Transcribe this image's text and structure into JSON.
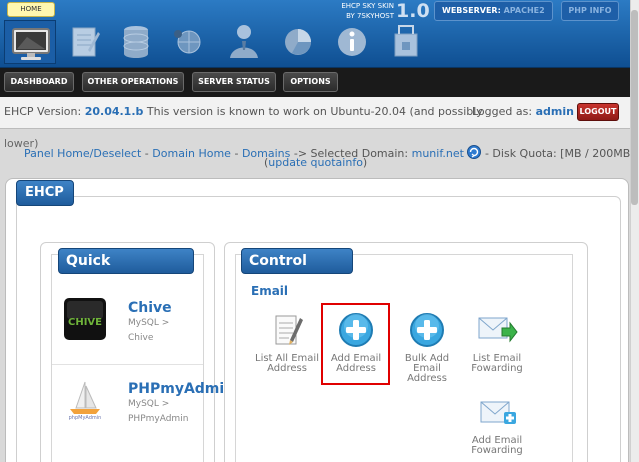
{
  "header": {
    "home_label": "HOME",
    "skin_line1": "EHCP SKY SKIN",
    "skin_line2": "BY 7SKYHOST",
    "skin_version": "1.0",
    "webserver_label": "WEBSERVER:",
    "webserver_value": "APACHE2",
    "phpinfo_label": "PHP INFO",
    "icons": [
      "monitor-icon",
      "notepad-icon",
      "database-icon",
      "network-globe-icon",
      "user-icon",
      "pie-chart-icon",
      "info-icon",
      "package-icon"
    ]
  },
  "nav": {
    "items": [
      {
        "label": "DASHBOARD"
      },
      {
        "label": "OTHER OPERATIONS"
      },
      {
        "label": "SERVER STATUS"
      },
      {
        "label": "OPTIONS"
      }
    ]
  },
  "status": {
    "version_prefix": "EHCP Version:",
    "version": "20.04.1.b",
    "version_note": "This version is known to work on Ubuntu-20.04 (and possibly",
    "version_note_wrap": "lower)",
    "logged_as_label": "Logged as:",
    "user": "admin",
    "logout_label": "LOGOUT"
  },
  "breadcrumb": {
    "panel_home": "Panel Home/Deselect",
    "sep1": "-",
    "domain_home": "Domain Home",
    "sep2": "-",
    "domains": "Domains",
    "arrow_text": "-> Selected Domain:",
    "domain": "munif.net",
    "quota_text": "- Disk Quota: [MB / 200MB]",
    "update_quota": "update quotainfo"
  },
  "sections": {
    "ehcp": "EHCP",
    "quick_ops": "Quick Operations",
    "control_panel": "Control panel",
    "email_heading": "Email"
  },
  "quick_ops": [
    {
      "name": "Chive",
      "sub1": "MySQL >",
      "sub2": "Chive",
      "icon": "chive-logo-icon"
    },
    {
      "name": "PHPmyAdmin",
      "sub1": "MySQL >",
      "sub2": "PHPmyAdmin",
      "icon": "phpmyadmin-logo-icon"
    }
  ],
  "control_items": [
    {
      "line1": "List All Email",
      "line2": "Address",
      "line3": "",
      "icon": "notepad-pen-icon"
    },
    {
      "line1": "Add Email",
      "line2": "Address",
      "line3": "",
      "icon": "plus-circle-icon"
    },
    {
      "line1": "Bulk Add",
      "line2": "Email",
      "line3": "Address",
      "icon": "plus-circle-icon"
    },
    {
      "line1": "List Email",
      "line2": "Fowarding",
      "line3": "",
      "icon": "mail-forward-icon"
    },
    {
      "line1": "Add Email",
      "line2": "Fowarding",
      "line3": "",
      "icon": "mail-add-icon"
    }
  ]
}
